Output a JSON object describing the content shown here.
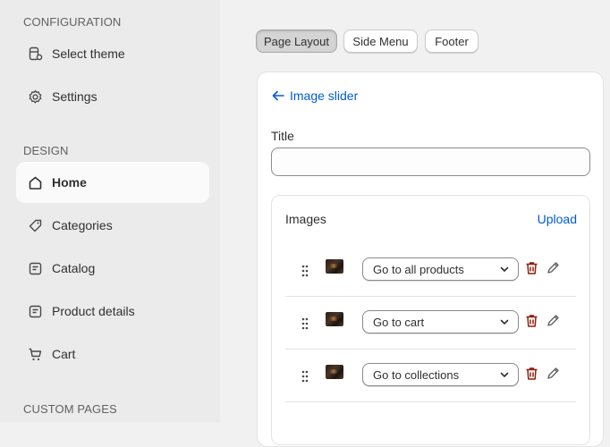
{
  "sidebar": {
    "sections": [
      "CONFIGURATION",
      "DESIGN",
      "CUSTOM PAGES"
    ],
    "items": [
      {
        "label": "Select theme",
        "icon": "theme-icon"
      },
      {
        "label": "Settings",
        "icon": "gear-icon"
      },
      {
        "label": "Home",
        "icon": "home-icon",
        "active": true
      },
      {
        "label": "Categories",
        "icon": "tag-icon"
      },
      {
        "label": "Catalog",
        "icon": "catalog-icon"
      },
      {
        "label": "Product details",
        "icon": "details-icon"
      },
      {
        "label": "Cart",
        "icon": "cart-icon"
      }
    ]
  },
  "tabs": [
    {
      "label": "Page Layout",
      "active": true
    },
    {
      "label": "Side Menu"
    },
    {
      "label": "Footer"
    }
  ],
  "editor": {
    "back_label": "Image slider",
    "title_label": "Title",
    "title_value": "",
    "images_label": "Images",
    "upload_label": "Upload",
    "images": [
      {
        "action": "Go to all products"
      },
      {
        "action": "Go to cart"
      },
      {
        "action": "Go to collections"
      }
    ]
  },
  "colors": {
    "accent": "#005bd3",
    "danger": "#8e1f0b",
    "sidebar_bg": "#ebebeb",
    "main_bg": "#f1f1f1"
  }
}
